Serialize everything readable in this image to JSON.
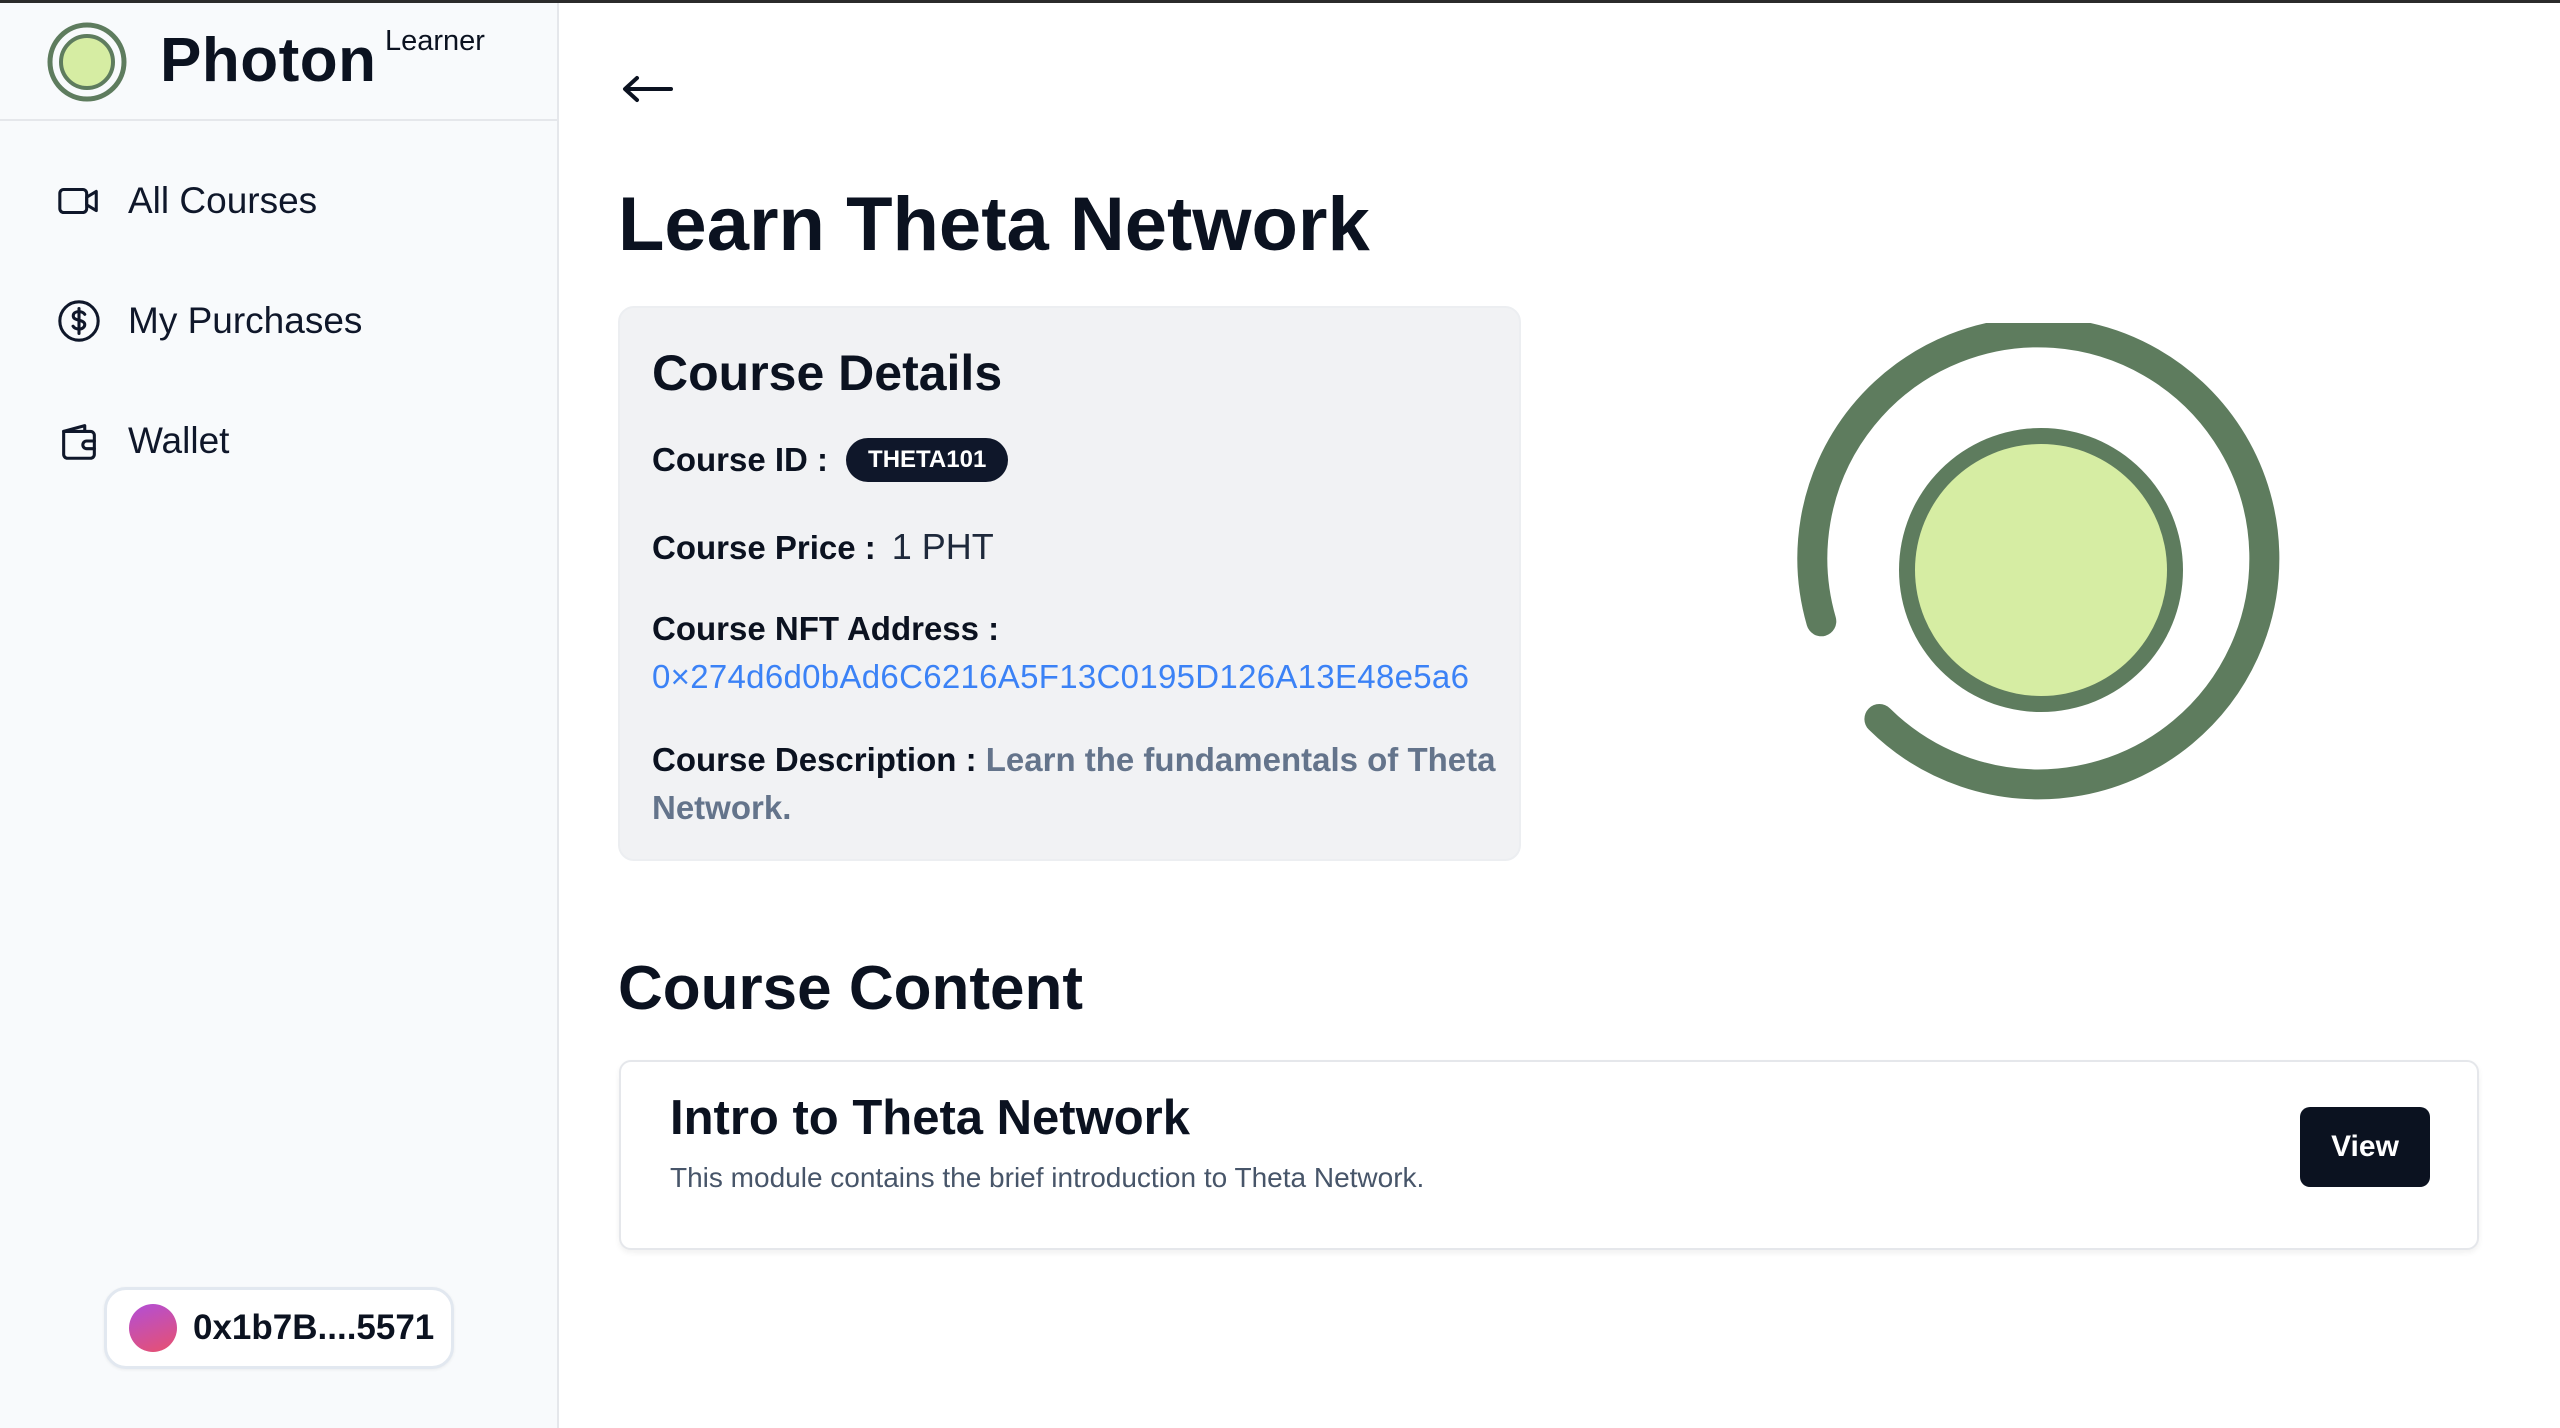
{
  "brand": {
    "name": "Photon",
    "role": "Learner"
  },
  "sidebar": {
    "items": [
      {
        "label": "All Courses",
        "icon": "video-camera-icon"
      },
      {
        "label": "My Purchases",
        "icon": "dollar-circle-icon"
      },
      {
        "label": "Wallet",
        "icon": "wallet-icon"
      }
    ]
  },
  "account": {
    "address": "0x1b7B....5571"
  },
  "page": {
    "back_icon": "arrow-left-icon",
    "title": "Learn Theta Network"
  },
  "course_details": {
    "title": "Course Details",
    "id_label": "Course ID :",
    "id_value": "THETA101",
    "price_label": "Course Price :",
    "price_value": "1 PHT",
    "nft_label": "Course NFT Address :",
    "nft_value": "0×274d6d0bAd6C6216A5F13C0195D126A13E48e5a6",
    "desc_label": "Course Description :",
    "desc_value": "Learn the fundamentals of Theta Network."
  },
  "course_content": {
    "title": "Course Content",
    "modules": [
      {
        "title": "Intro to Theta Network",
        "description": "This module contains the brief introduction to Theta Network.",
        "action_label": "View"
      }
    ]
  },
  "colors": {
    "logo_ring": "#5e7c5e",
    "logo_fill": "#d6eda3",
    "link": "#3b82f6",
    "dark": "#0b1220",
    "card_bg": "#f1f2f4"
  }
}
